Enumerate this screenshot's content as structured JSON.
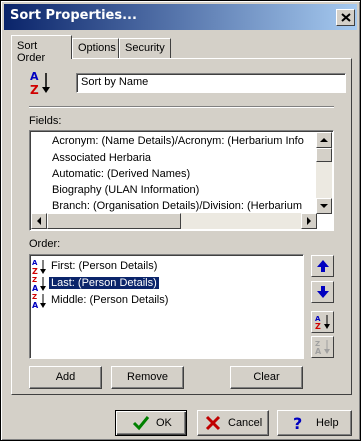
{
  "window": {
    "title": "Sort Properties..."
  },
  "tabs": [
    {
      "label": "Sort Order",
      "active": true
    },
    {
      "label": "Options",
      "active": false
    },
    {
      "label": "Security",
      "active": false
    }
  ],
  "sort_name": {
    "value": "Sort by Name"
  },
  "fields": {
    "label": "Fields:",
    "items": [
      "Acronym: (Name Details)/Acronym: (Herbarium Info",
      "Associated Herbaria",
      "Automatic: (Derived Names)",
      "Biography (ULAN Information)",
      "Branch: (Organisation Details)/Division: (Herbarium"
    ]
  },
  "order": {
    "label": "Order:",
    "items": [
      {
        "label": "First: (Person Details)",
        "selected": false
      },
      {
        "label": "Last: (Person Details)",
        "selected": true
      },
      {
        "label": "Middle: (Person Details)",
        "selected": false
      }
    ]
  },
  "buttons": {
    "add": "Add",
    "remove": "Remove",
    "clear": "Clear",
    "ok": "OK",
    "cancel": "Cancel",
    "help": "Help"
  },
  "colors": {
    "title_start": "#0a246a",
    "title_end": "#a6caf0",
    "selection": "#0a246a",
    "face": "#d4d0c8"
  }
}
